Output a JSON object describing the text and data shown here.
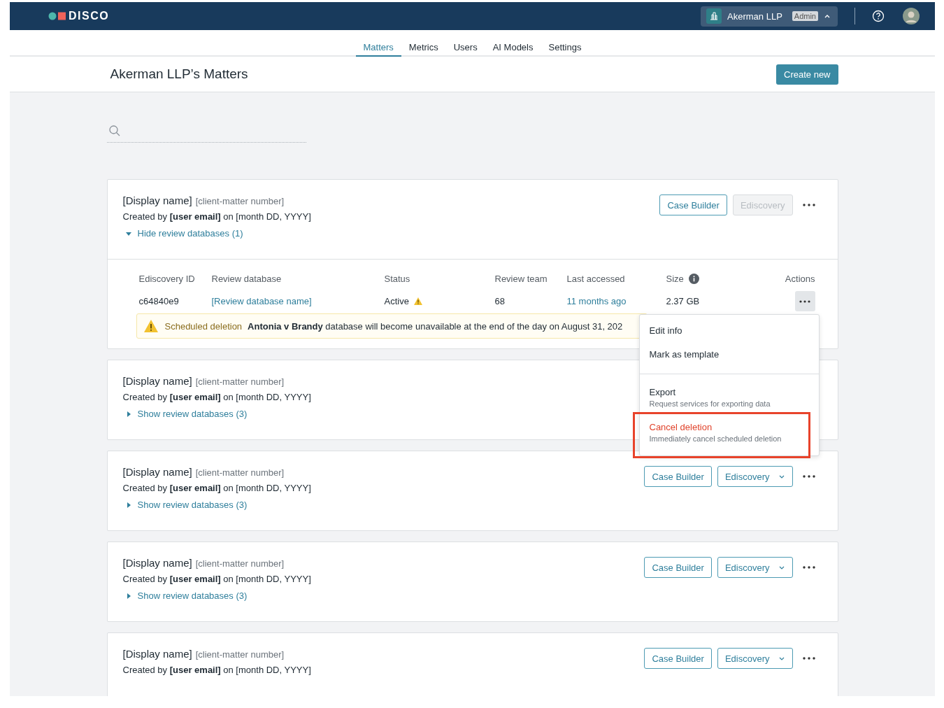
{
  "header": {
    "logo": "DISCO",
    "org": {
      "name": "Akerman LLP",
      "badge": "Admin",
      "expanded": true
    }
  },
  "nav": [
    {
      "label": "Matters",
      "selected": true
    },
    {
      "label": "Metrics",
      "selected": false
    },
    {
      "label": "Users",
      "selected": false
    },
    {
      "label": "AI Models",
      "selected": false
    },
    {
      "label": "Settings",
      "selected": false
    }
  ],
  "page": {
    "title": "Akerman LLP’s Matters",
    "create_button": "Create new"
  },
  "matters": [
    {
      "display_name": "[Display name]",
      "client_matter": "[client-matter number]",
      "created": "Created by **[user email]** on [month DD, YYYY]",
      "toggle": {
        "label": "Hide review databases (1)",
        "expanded": true
      },
      "buttons": [
        {
          "label": "Case Builder",
          "kind": "outline"
        },
        {
          "label": "Ediscovery",
          "kind": "disabled"
        }
      ],
      "more_visible": true,
      "databases": {
        "columns": [
          "Ediscovery ID",
          "Review database",
          "Status",
          "Review team",
          "Last accessed",
          "Size",
          "Actions"
        ],
        "rows": [
          {
            "id": "c64840e9",
            "name": "[Review database name]",
            "status": "Active",
            "status_warning": true,
            "team": "68",
            "last_accessed": "11 months ago",
            "size": "2.37 GB",
            "menu_open": true
          }
        ],
        "notice": {
          "label": "Scheduled deletion",
          "text": "**Antonia v Brandy** database will become unavailable at the end of the day on August 31, 202"
        }
      }
    },
    {
      "display_name": "[Display name]",
      "client_matter": "[client-matter number]",
      "created": "Created by **[user email]** on [month DD, YYYY]",
      "toggle": {
        "label": "Show review databases (3)",
        "expanded": false
      },
      "more_visible": false
    },
    {
      "display_name": "[Display name]",
      "client_matter": "[client-matter number]",
      "created": "Created by **[user email]** on [month DD, YYYY]",
      "toggle": {
        "label": "Show review databases (3)",
        "expanded": false
      },
      "buttons": [
        {
          "label": "Case Builder",
          "kind": "outline"
        },
        {
          "label": "Ediscovery",
          "kind": "dropdown"
        }
      ],
      "more_visible": true
    },
    {
      "display_name": "[Display name]",
      "client_matter": "[client-matter number]",
      "created": "Created by **[user email]** on [month DD, YYYY]",
      "toggle": {
        "label": "Show review databases (3)",
        "expanded": false
      },
      "buttons": [
        {
          "label": "Case Builder",
          "kind": "outline"
        },
        {
          "label": "Ediscovery",
          "kind": "dropdown"
        }
      ],
      "more_visible": true
    },
    {
      "display_name": "[Display name]",
      "client_matter": "[client-matter number]",
      "created": "Created by **[user email]** on [month DD, YYYY]",
      "buttons": [
        {
          "label": "Case Builder",
          "kind": "outline"
        },
        {
          "label": "Ediscovery",
          "kind": "dropdown"
        }
      ],
      "more_visible": true
    }
  ],
  "menu": {
    "items": [
      {
        "label": "Edit info",
        "separator_before": false,
        "danger": false,
        "highlighted": false
      },
      {
        "label": "Mark as template",
        "separator_before": false,
        "danger": false,
        "highlighted": false
      },
      {
        "label": "Export",
        "description": "Request services for exporting data",
        "separator_before": true,
        "danger": false,
        "highlighted": false
      },
      {
        "label": "Cancel deletion",
        "description": "Immediately cancel scheduled deletion",
        "separator_before": false,
        "danger": true,
        "highlighted": true
      }
    ]
  }
}
